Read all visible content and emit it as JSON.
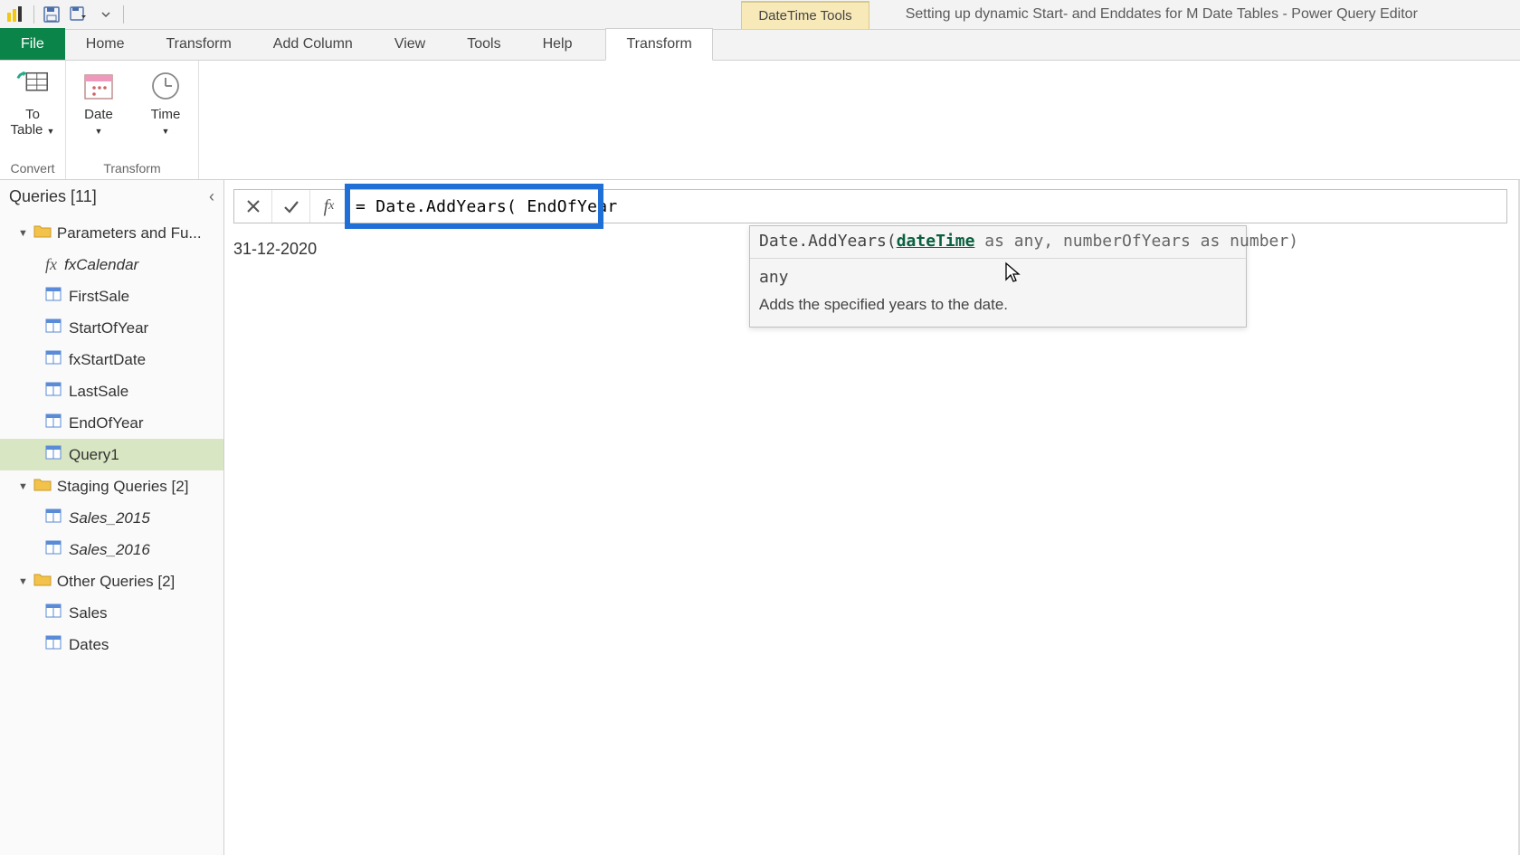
{
  "title_bar": {
    "context_tool_label": "DateTime Tools",
    "document_title": "Setting up dynamic Start- and Enddates for M Date Tables - Power Query Editor"
  },
  "ribbon": {
    "tabs": {
      "file": "File",
      "home": "Home",
      "transform": "Transform",
      "add_column": "Add Column",
      "view": "View",
      "tools": "Tools",
      "help": "Help",
      "context_transform": "Transform"
    },
    "convert_group": {
      "to_table_label": "To\nTable",
      "group_title": "Convert"
    },
    "transform_group": {
      "date_label": "Date",
      "time_label": "Time",
      "group_title": "Transform"
    }
  },
  "queries_panel": {
    "header": "Queries [11]",
    "folders": {
      "parameters": "Parameters and Fu...",
      "staging": "Staging Queries [2]",
      "other": "Other Queries [2]"
    },
    "items": {
      "fxCalendar": "fxCalendar",
      "FirstSale": "FirstSale",
      "StartOfYear": "StartOfYear",
      "fxStartDate": "fxStartDate",
      "LastSale": "LastSale",
      "EndOfYear": "EndOfYear",
      "Query1": "Query1",
      "Sales_2015": "Sales_2015",
      "Sales_2016": "Sales_2016",
      "Sales": "Sales",
      "Dates": "Dates"
    }
  },
  "formula_bar": {
    "value": "= Date.AddYears( EndOfYear"
  },
  "result_value": "31-12-2020",
  "intellisense": {
    "fn_name": "Date.AddYears(",
    "param_active": "dateTime",
    "sig_rest": " as any, numberOfYears as number)",
    "type_line": "any",
    "description": "Adds the specified years to the date."
  }
}
